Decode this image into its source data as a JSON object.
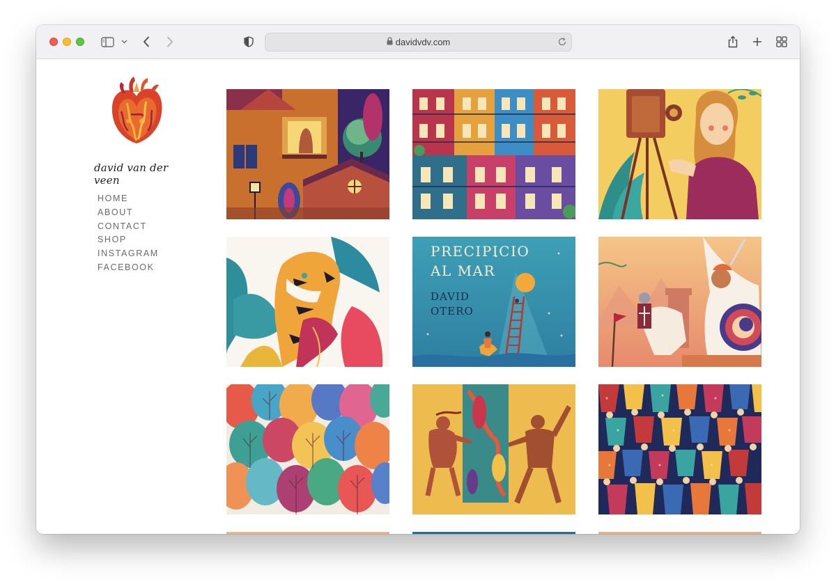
{
  "browser": {
    "url": "davidvdv.com"
  },
  "site": {
    "brand_name": "david van der veen",
    "nav": [
      "HOME",
      "ABOUT",
      "CONTACT",
      "SHOP",
      "INSTAGRAM",
      "FACEBOOK"
    ]
  },
  "gallery": {
    "tiles": [
      {
        "name": "night-window-illustration"
      },
      {
        "name": "colorful-houses-illustration"
      },
      {
        "name": "woman-camera-illustration"
      },
      {
        "name": "tiger-leaves-illustration"
      },
      {
        "name": "precipicio-al-mar-cover",
        "title_line1": "PRECIPICIO",
        "title_line2": "AL MAR",
        "author_line1": "DAVID",
        "author_line2": "OTERO"
      },
      {
        "name": "knight-battle-illustration"
      },
      {
        "name": "watercolor-trees-illustration"
      },
      {
        "name": "dancing-couple-illustration"
      },
      {
        "name": "crowd-pattern-illustration"
      }
    ]
  },
  "colors": {
    "window_chrome": "#f1f1f3",
    "nav_text": "#6a6a6a"
  }
}
